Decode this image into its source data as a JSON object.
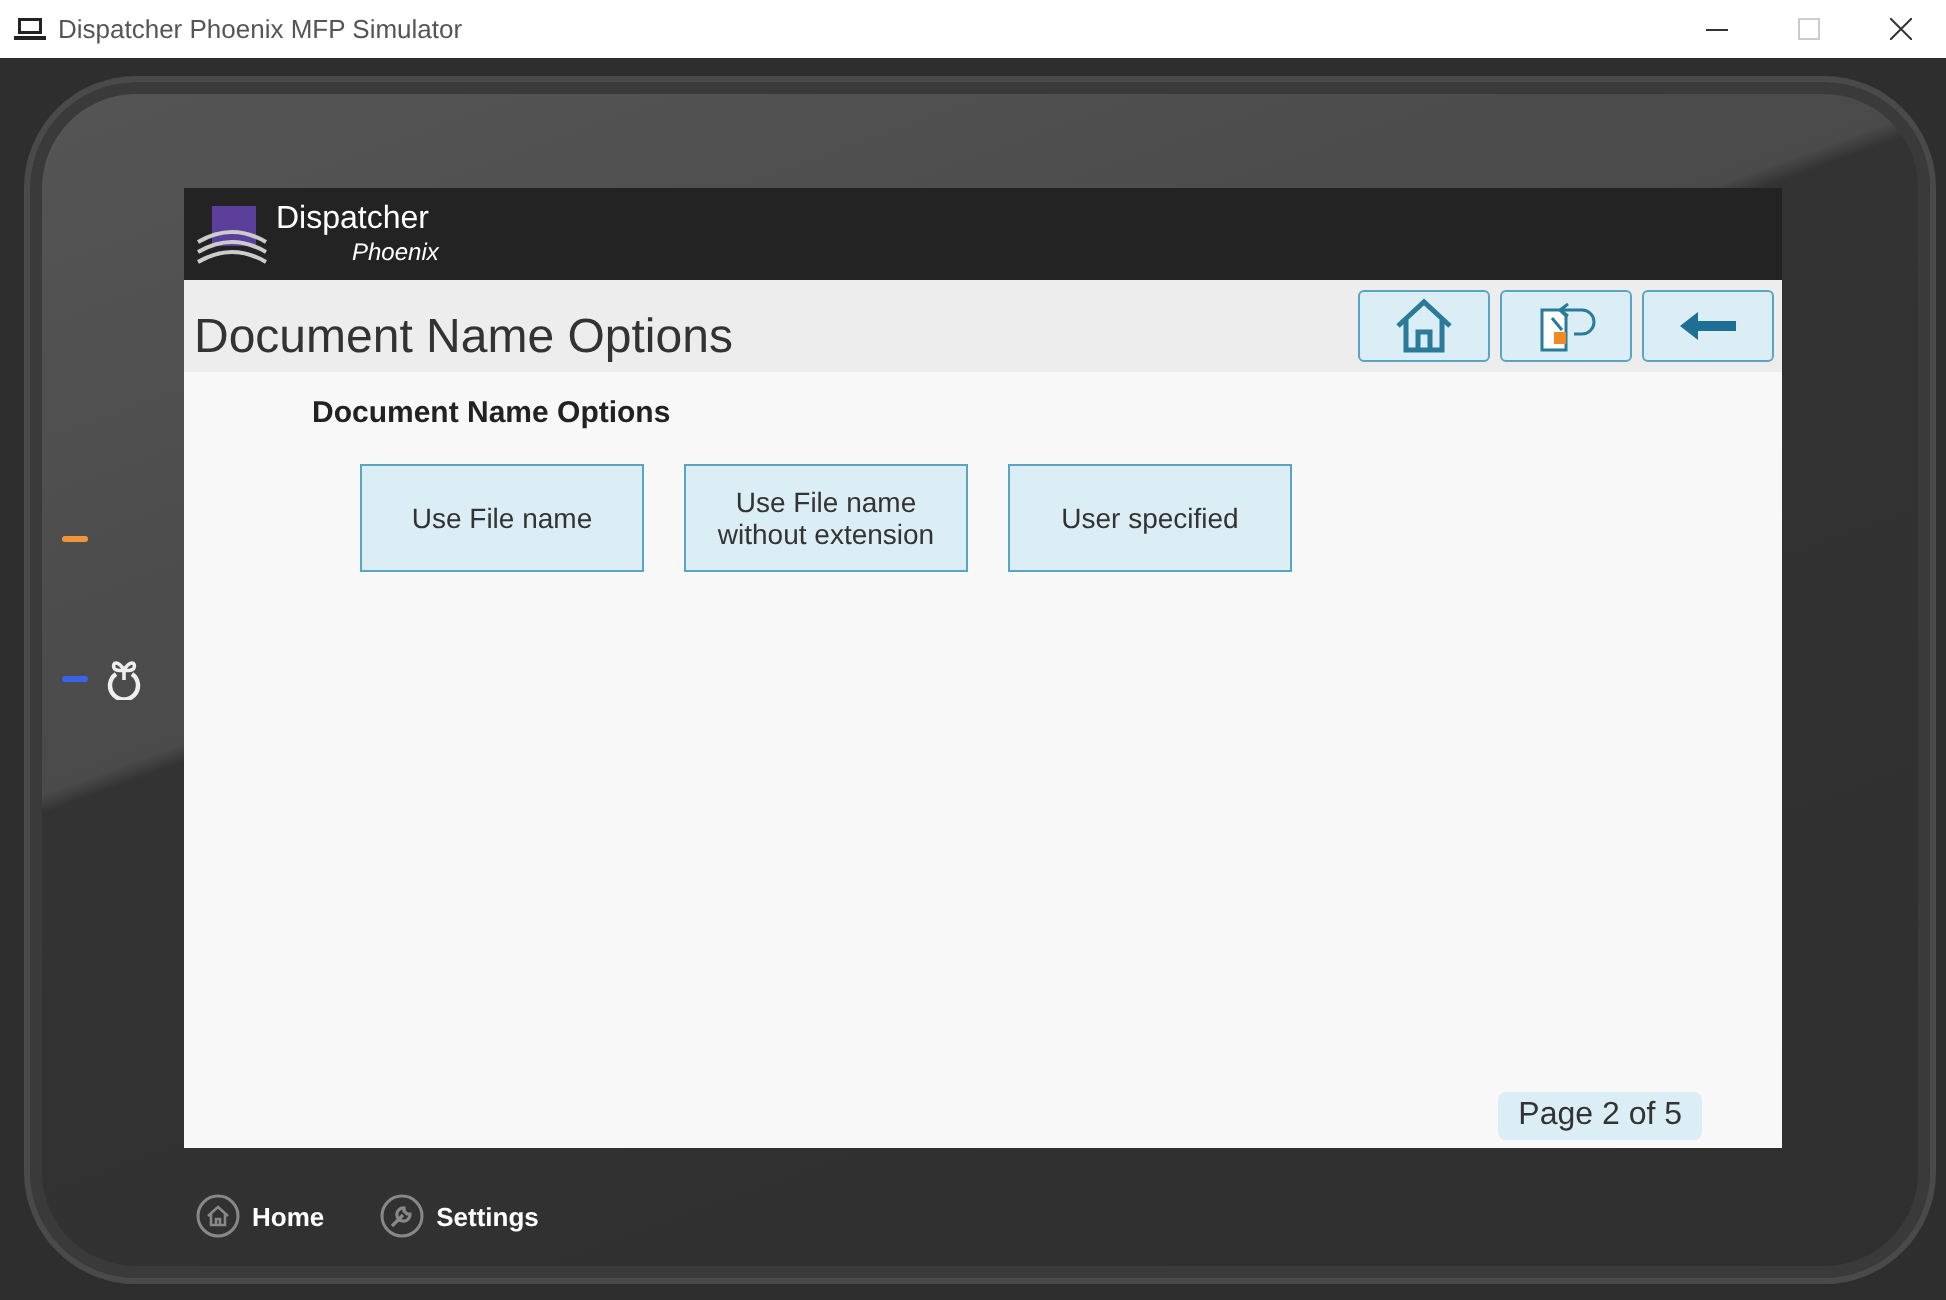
{
  "window": {
    "title": "Dispatcher Phoenix MFP Simulator"
  },
  "indicators": [
    {
      "color": "#f0963a"
    },
    {
      "color": "#3a64e8"
    }
  ],
  "header": {
    "brand": "Dispatcher",
    "sub_brand": "Phoenix"
  },
  "page_title": "Document Name Options",
  "section_heading": "Document Name Options",
  "options": [
    {
      "label": "Use File name"
    },
    {
      "label": "Use File name without extension"
    },
    {
      "label": "User specified"
    }
  ],
  "page_indicator": "Page 2 of 5",
  "bottom_nav": [
    {
      "label": "Home",
      "kind": "home"
    },
    {
      "label": "Settings",
      "kind": "settings"
    }
  ]
}
